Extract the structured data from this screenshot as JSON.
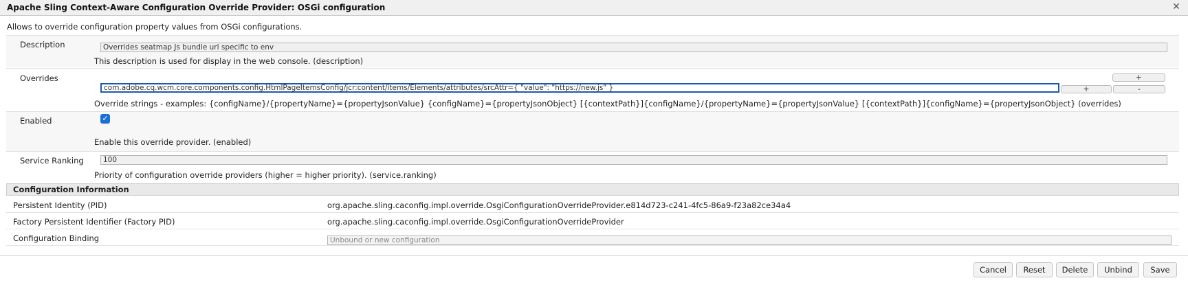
{
  "dialog": {
    "title": "Apache Sling Context-Aware Configuration Override Provider: OSGi configuration",
    "subtitle": "Allows to override configuration property values from OSGi configurations."
  },
  "fields": {
    "description": {
      "label": "Description",
      "value": "Overrides seatmap Js bundle url specific to env",
      "help": "This description is used for display in the web console. (description)"
    },
    "overrides": {
      "label": "Overrides",
      "value": "com.adobe.cq.wcm.core.components.config.HtmlPageItemsConfig/jcr:content/items/Elements/attributes/srcAttr={ \"value\": \"https://new.js\" }",
      "add_top": "+",
      "add_row": "+",
      "remove_row": "-",
      "help": "Override strings - examples: {configName}/{propertyName}={propertyJsonValue} {configName}={propertyJsonObject} [{contextPath}]{configName}/{propertyName}={propertyJsonValue} [{contextPath}]{configName}={propertyJsonObject} (overrides)"
    },
    "enabled": {
      "label": "Enabled",
      "checked": true,
      "check_mark": "✓",
      "help": "Enable this override provider. (enabled)"
    },
    "service_ranking": {
      "label": "Service Ranking",
      "value": "100",
      "help": "Priority of configuration override providers (higher = higher priority). (service.ranking)"
    }
  },
  "config_info": {
    "heading": "Configuration Information",
    "rows": [
      {
        "key": "Persistent Identity (PID)",
        "value": "org.apache.sling.caconfig.impl.override.OsgiConfigurationOverrideProvider.e814d723-c241-4fc5-86a9-f23a82ce34a4"
      },
      {
        "key": "Factory Persistent Identifier (Factory PID)",
        "value": "org.apache.sling.caconfig.impl.override.OsgiConfigurationOverrideProvider"
      },
      {
        "key": "Configuration Binding",
        "placeholder": "Unbound or new configuration"
      }
    ]
  },
  "buttons": {
    "cancel": "Cancel",
    "reset": "Reset",
    "delete": "Delete",
    "unbind": "Unbind",
    "save": "Save"
  },
  "icons": {
    "close": "close-icon"
  },
  "colors": {
    "focus_border": "#1a5aa8",
    "checkbox": "#1a6fd6"
  }
}
